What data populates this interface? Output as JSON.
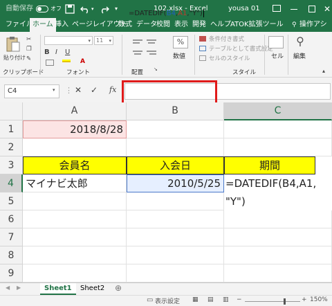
{
  "titlebar": {
    "autosave": "自動保存",
    "autosave_state": "オフ",
    "doc_title": "102.xlsx - Excel",
    "user": "yousa 01"
  },
  "tabs": [
    "ファイル",
    "ホーム",
    "挿入",
    "ページレイアウト",
    "数式",
    "データ",
    "校閲",
    "表示",
    "開発",
    "ヘルプ",
    "ATOK拡張ツール",
    "操作アシ"
  ],
  "active_tab": "ホーム",
  "ribbon": {
    "paste": "貼り付け",
    "clipboard": "クリップボード",
    "font_size": "11",
    "font_group": "フォント",
    "align_group": "配置",
    "number_btn": "数値",
    "cond_format": "条件付き書式",
    "table_format": "テーブルとして書式設定",
    "cell_style": "セルのスタイル",
    "style_group": "スタイル",
    "cells_btn": "セル",
    "edit_btn": "編集",
    "bold": "B",
    "italic": "I",
    "underline": "U"
  },
  "formula_bar": {
    "name_box": "C4",
    "fx": "fx",
    "formula_prefix": "=DATEDIF(",
    "ref_b4": "B4",
    "comma1": ",",
    "ref_a1": "A1",
    "formula_suffix": ",\"Y\")"
  },
  "columns": [
    "A",
    "B",
    "C"
  ],
  "rows": [
    "1",
    "2",
    "3",
    "4",
    "5",
    "6",
    "7",
    "8",
    "9"
  ],
  "cells": {
    "A1": "2018/8/28",
    "A3": "会員名",
    "B3": "入会日",
    "C3": "期間",
    "A4": "マイナビ太郎",
    "B4": "2010/5/25",
    "C4_line1": "=DATEDIF(B4,A1,",
    "C4_line2": "\"Y\")"
  },
  "sheets": [
    "Sheet1",
    "Sheet2"
  ],
  "active_sheet": "Sheet1",
  "statusbar": {
    "display_settings": "表示設定",
    "zoom": "150%"
  },
  "colors": {
    "excel_green": "#217346",
    "header_yellow": "#ffff00",
    "a1_fill": "#fce4e4",
    "highlight_red": "#e01b1b"
  }
}
